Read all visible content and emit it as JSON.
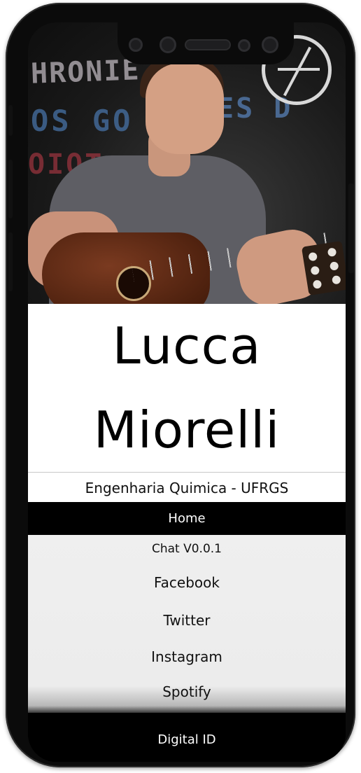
{
  "profile": {
    "first_name": "Lucca",
    "last_name": "Miorelli",
    "subtitle": "Engenharia Quimica - UFRGS"
  },
  "photo": {
    "chalk_text": [
      "HRONIE",
      "OS GO",
      "ES D",
      "OIOT"
    ]
  },
  "nav": {
    "home_label": "Home",
    "items": [
      {
        "label": "Chat V0.0.1"
      },
      {
        "label": "Facebook"
      },
      {
        "label": "Twitter"
      },
      {
        "label": "Instagram"
      },
      {
        "label": "Spotify"
      }
    ],
    "footer_label": "Digital ID"
  },
  "colors": {
    "accent_bar": "#000000",
    "menu_bg": "#eeeeee",
    "text": "#111111"
  }
}
